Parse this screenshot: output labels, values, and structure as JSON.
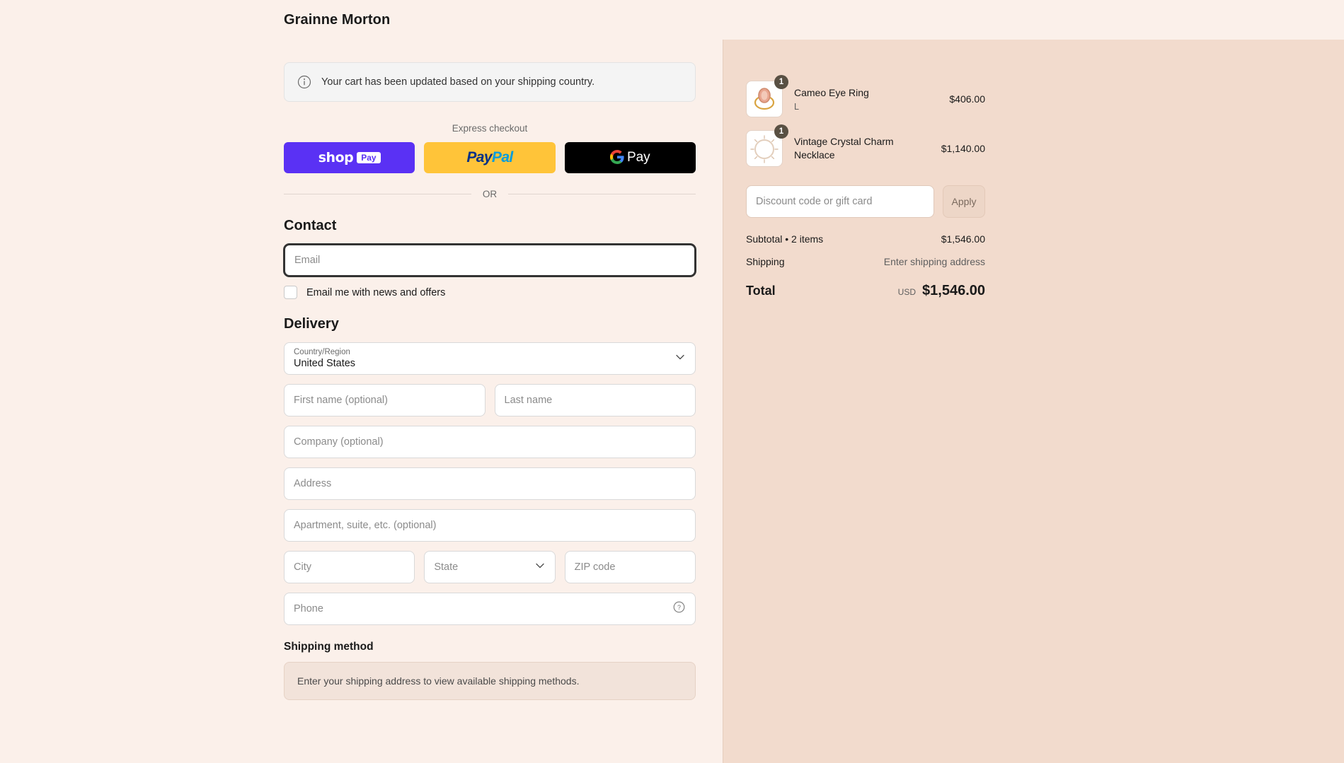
{
  "header": {
    "store_name": "Grainne Morton"
  },
  "banner": {
    "icon": "info-circle-icon",
    "text": "Your cart has been updated based on your shipping country."
  },
  "express": {
    "label": "Express checkout",
    "wallets": [
      {
        "name": "shop-pay",
        "word": "shop",
        "pill": "Pay",
        "bg": "#5a31f4"
      },
      {
        "name": "paypal",
        "pay": "Pay",
        "pal": "Pal",
        "bg": "#ffc439"
      },
      {
        "name": "google-pay",
        "word": "Pay",
        "bg": "#000000"
      }
    ]
  },
  "divider": {
    "text": "OR"
  },
  "contact": {
    "title": "Contact",
    "email_placeholder": "Email",
    "newsletter_label": "Email me with news and offers",
    "newsletter_checked": false
  },
  "delivery": {
    "title": "Delivery",
    "country_label": "Country/Region",
    "country_value": "United States",
    "first_name_placeholder": "First name (optional)",
    "last_name_placeholder": "Last name",
    "company_placeholder": "Company (optional)",
    "address_placeholder": "Address",
    "apartment_placeholder": "Apartment, suite, etc. (optional)",
    "city_placeholder": "City",
    "state_placeholder": "State",
    "zip_placeholder": "ZIP code",
    "phone_placeholder": "Phone"
  },
  "shipping_method": {
    "title": "Shipping method",
    "notice": "Enter your shipping address to view available shipping methods."
  },
  "summary": {
    "items": [
      {
        "title": "Cameo Eye Ring",
        "variant": "L",
        "qty": "1",
        "price": "$406.00",
        "thumb": "ring-thumbnail"
      },
      {
        "title": "Vintage Crystal Charm Necklace",
        "variant": "",
        "qty": "1",
        "price": "$1,140.00",
        "thumb": "necklace-thumbnail"
      }
    ],
    "discount_placeholder": "Discount code or gift card",
    "apply_label": "Apply",
    "subtotal_label": "Subtotal • 2 items",
    "subtotal_value": "$1,546.00",
    "shipping_label": "Shipping",
    "shipping_value": "Enter shipping address",
    "total_label": "Total",
    "total_currency": "USD",
    "total_value": "$1,546.00"
  },
  "colors": {
    "page_bg": "#fbf0ea",
    "summary_bg": "#f2dbcd",
    "shop_pay": "#5a31f4",
    "paypal": "#ffc439",
    "gpay": "#000000",
    "badge": "#595043"
  }
}
